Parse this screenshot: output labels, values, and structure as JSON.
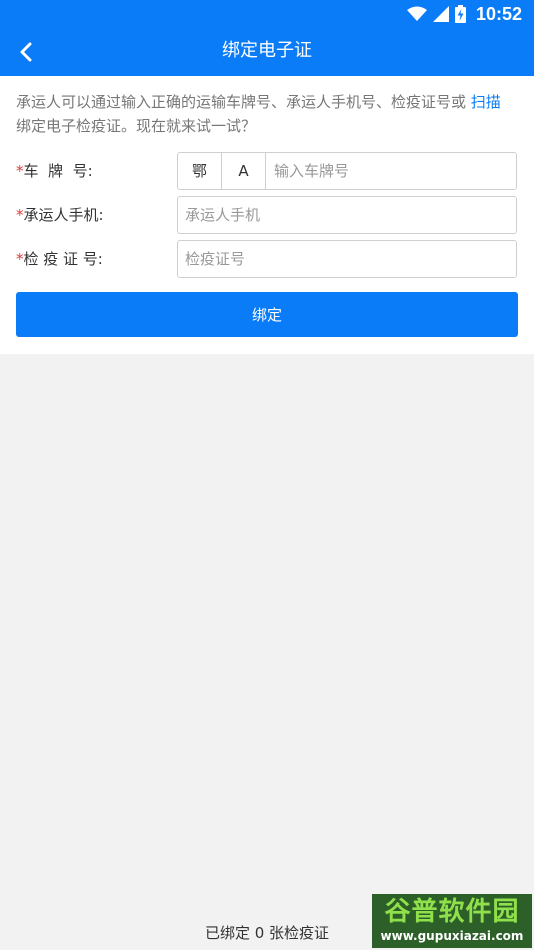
{
  "status_bar": {
    "time": "10:52",
    "icons": [
      "wifi-icon",
      "signal-icon",
      "battery-charging-icon"
    ]
  },
  "app_bar": {
    "back_icon": "chevron-left-icon",
    "title": "绑定电子证"
  },
  "intro": {
    "text_before": "承运人可以通过输入正确的运输车牌号、承运人手机号、检疫证号或 ",
    "scan_link": "扫描",
    "text_after": " 绑定电子检疫证。现在就来试一试？"
  },
  "form": {
    "required_mark": "*",
    "plate": {
      "label": "车  牌  号:",
      "province": "鄂",
      "letter": "A",
      "placeholder": "输入车牌号",
      "value": ""
    },
    "phone": {
      "label": "承运人手机:",
      "placeholder": "承运人手机",
      "value": ""
    },
    "cert": {
      "label": "检 疫 证 号:",
      "placeholder": "检疫证号",
      "value": ""
    },
    "submit_label": "绑定"
  },
  "footer": {
    "bound_text": "已绑定 0 张检疫证"
  },
  "watermark": {
    "title": "谷普软件园",
    "url": "www.gupuxiazai.com"
  },
  "colors": {
    "primary": "#0a7cf8",
    "required": "#e53935",
    "background": "#f2f2f2"
  }
}
